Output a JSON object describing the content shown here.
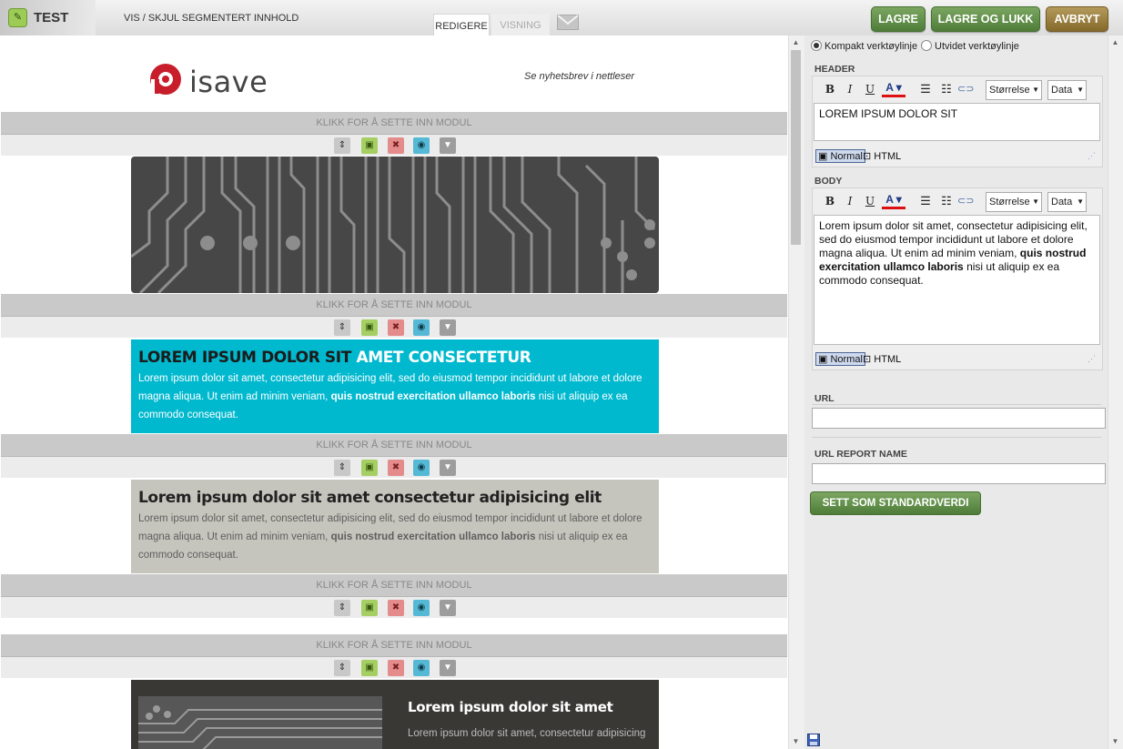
{
  "app": {
    "title": "TEST",
    "visibility_link": "VIS / SKJUL SEGMENTERT INNHOLD"
  },
  "tabs": {
    "edit": "REDIGERE",
    "view": "VISNING"
  },
  "actions": {
    "save": "LAGRE",
    "save_close": "LAGRE OG LUKK",
    "cancel": "AVBRYT"
  },
  "colors": {
    "cyan": "#00b9cf",
    "green": "#5f8c47",
    "brown": "#9a7f3e"
  },
  "newsletter": {
    "logo_text": "isave",
    "view_in_browser": "Se nyhetsbrev i nettleser",
    "insert_module": "KLIKK FOR Å SETTE INN MODUL",
    "block2": {
      "title_a": "LOREM IPSUM DOLOR SIT",
      "title_b": "AMET CONSECTETUR",
      "text_a": "Lorem ipsum dolor sit amet, consectetur adipisicing elit, sed do eiusmod tempor incididunt ut labore et dolore magna aliqua. Ut enim ad minim veniam,",
      "text_bold": "quis nostrud exercitation ullamco laboris",
      "text_b": "nisi ut aliquip ex ea commodo consequat."
    },
    "block3": {
      "title": "Lorem ipsum dolor sit amet consectetur adipisicing elit",
      "text_a": "Lorem ipsum dolor sit amet, consectetur adipisicing elit, sed do eiusmod tempor incididunt ut labore et dolore magna aliqua. Ut enim ad minim veniam,",
      "text_bold": "quis nostrud exercitation ullamco laboris",
      "text_b": "nisi ut aliquip ex ea commodo consequat."
    },
    "block4": {
      "title": "Lorem ipsum dolor sit amet",
      "text": "Lorem ipsum dolor sit amet, consectetur adipisicing"
    }
  },
  "panel": {
    "toolbar_compact": "Kompakt verktøylinje",
    "toolbar_extended": "Utvidet verktøylinje",
    "header_label": "HEADER",
    "header_value": "LOREM IPSUM DOLOR SIT",
    "body_label": "BODY",
    "body_text_a": "Lorem ipsum dolor sit amet, consectetur adipisicing elit, sed do eiusmod tempor incididunt ut labore et dolore magna aliqua. Ut enim ad minim veniam,",
    "body_bold": "quis nostrud exercitation ullamco laboris",
    "body_text_b": "nisi ut aliquip ex ea commodo consequat.",
    "size_select": "Størrelse",
    "data_select": "Data",
    "mode_normal": "Normal",
    "mode_html": "HTML",
    "url_label": "URL",
    "url_value": "",
    "url_report_label": "URL REPORT NAME",
    "url_report_value": "",
    "set_default": "SETT SOM STANDARDVERDI"
  }
}
